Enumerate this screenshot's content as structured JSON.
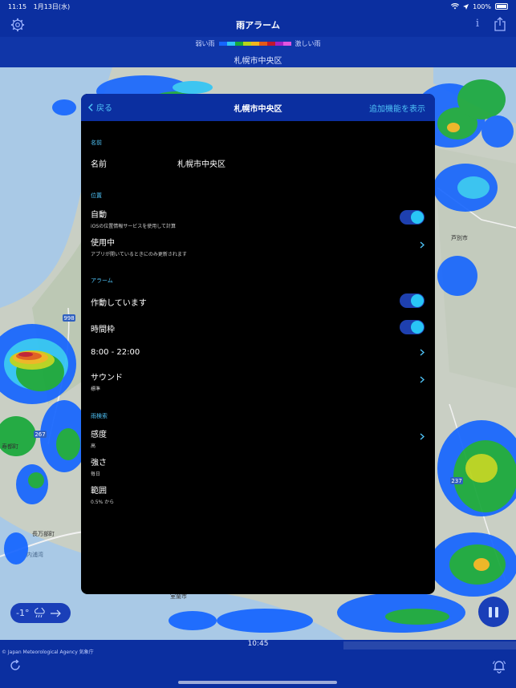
{
  "status": {
    "time": "11:15",
    "date": "1月13日(水)",
    "battery": "100%"
  },
  "app": {
    "title": "雨アラーム"
  },
  "legend": {
    "weak": "弱い雨",
    "strong": "激しい雨",
    "place": "札幌市中央区",
    "colors": [
      "#1565ff",
      "#2ec4f6",
      "#18a83a",
      "#b9d41a",
      "#f2b51c",
      "#e35a17",
      "#c0182d",
      "#a223c7",
      "#e055e0"
    ]
  },
  "modal": {
    "back_label": "戻る",
    "title": "札幌市中央区",
    "more_label": "追加機能を表示",
    "sections": {
      "name": {
        "label": "名前",
        "row_title": "名前",
        "row_value": "札幌市中央区"
      },
      "location": {
        "label": "位置",
        "auto_title": "自動",
        "auto_sub": "iOSの位置情報サービスを使用して計算",
        "auto_on": true,
        "use_title": "使用中",
        "use_sub": "アプリが開いているときにのみ更新されます"
      },
      "alarm": {
        "label": "アラーム",
        "active_title": "作動しています",
        "active_on": true,
        "timeframe_title": "時間枠",
        "timeframe_on": true,
        "range_title": "8:00 - 22:00",
        "sound_title": "サウンド",
        "sound_sub": "標準"
      },
      "detection": {
        "label": "雨検索",
        "sensitivity_title": "感度",
        "sensitivity_sub": "高",
        "intensity_title": "強さ",
        "intensity_sub": "毎日",
        "range_title": "範囲",
        "range_sub": "0.5% から"
      }
    }
  },
  "map": {
    "labels": [
      "998",
      "267",
      "237",
      "芦別市",
      "寿都町",
      "長万部町",
      "内浦湾",
      "室蘭市"
    ]
  },
  "overlay": {
    "temperature": "-1°"
  },
  "bottom": {
    "time": "10:45",
    "attribution": "© Japan Meteorological Agency 気象庁"
  }
}
